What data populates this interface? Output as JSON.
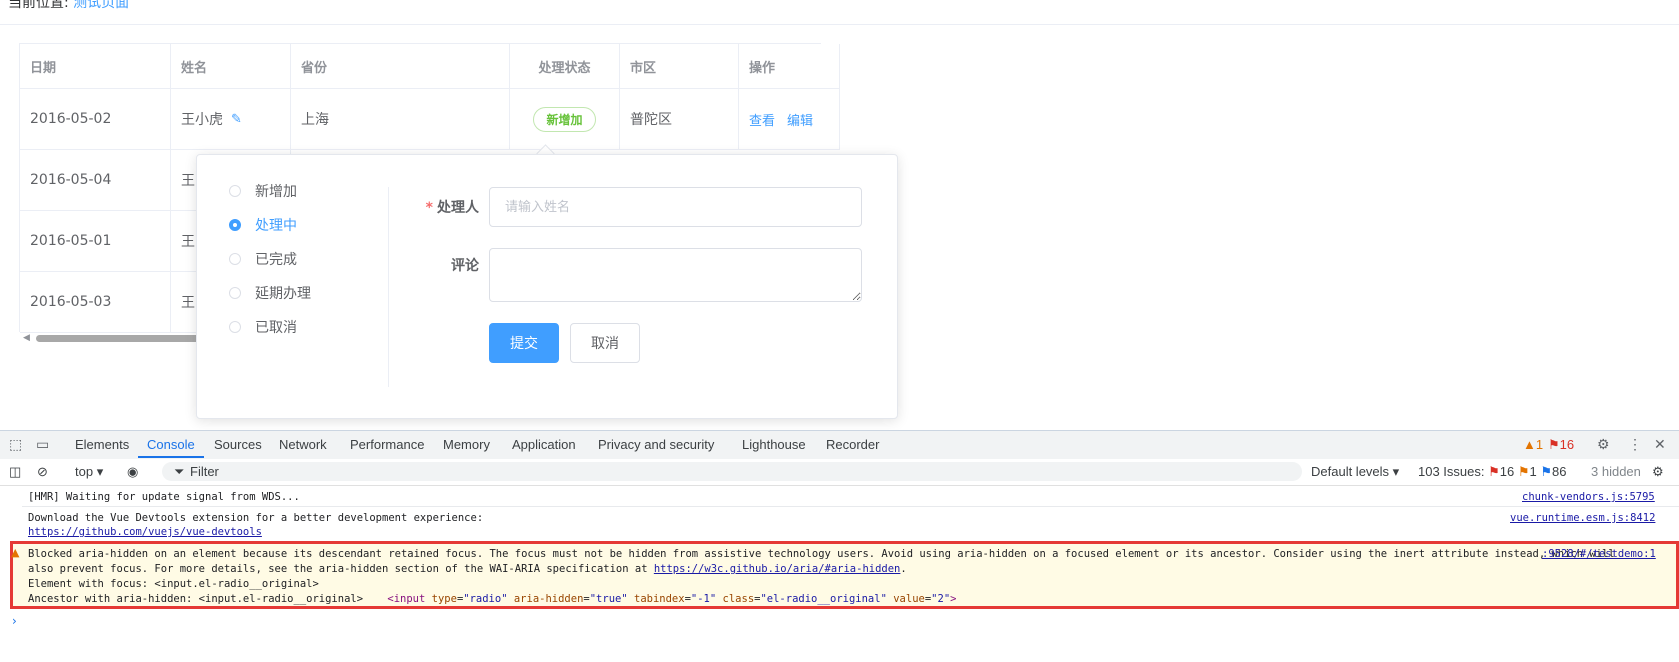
{
  "breadcrumb": {
    "label": "当前位置:",
    "current": "测试页面"
  },
  "table": {
    "headers": [
      "日期",
      "姓名",
      "省份",
      "处理状态",
      "市区",
      "操作"
    ],
    "rows": [
      {
        "date": "2016-05-02",
        "name": "王小虎",
        "province": "上海",
        "status": "新增加",
        "district": "普陀区",
        "actions": [
          "查看",
          "编辑"
        ]
      },
      {
        "date": "2016-05-04",
        "name": "王"
      },
      {
        "date": "2016-05-01",
        "name": "王"
      },
      {
        "date": "2016-05-03",
        "name": "王"
      }
    ]
  },
  "popover": {
    "radios": [
      {
        "label": "新增加",
        "checked": false
      },
      {
        "label": "处理中",
        "checked": true
      },
      {
        "label": "已完成",
        "checked": false
      },
      {
        "label": "延期办理",
        "checked": false
      },
      {
        "label": "已取消",
        "checked": false
      }
    ],
    "handler_label": "处理人",
    "handler_placeholder": "请输入姓名",
    "comment_label": "评论",
    "submit": "提交",
    "cancel": "取消"
  },
  "devtools": {
    "tabs": [
      "Elements",
      "Console",
      "Sources",
      "Network",
      "Performance",
      "Memory",
      "Application",
      "Privacy and security",
      "Lighthouse",
      "Recorder"
    ],
    "active_tab": "Console",
    "warn_count": "1",
    "error_count": "16",
    "toolbar": {
      "context": "top",
      "filter_placeholder": "Filter",
      "levels": "Default levels",
      "issues_label": "103 Issues:",
      "issues_errors": "16",
      "issues_warnings": "1",
      "issues_info": "86",
      "hidden": "3 hidden"
    },
    "console": {
      "line1": "[HMR] Waiting for update signal from WDS...",
      "line1_src": "chunk-vendors.js:5795",
      "line2a": "Download the Vue Devtools extension for a better development experience:",
      "line2b": "https://github.com/vuejs/vue-devtools",
      "line2_src": "vue.runtime.esm.js:8412",
      "warn_line1": "Blocked aria-hidden on an element because its descendant retained focus. The focus must not be hidden from assistive technology users. Avoid using aria-hidden on a focused element or its ancestor. Consider using the inert attribute instead, which will",
      "warn_src": ":9528/#/testdemo:1",
      "warn_line2a": "also prevent focus. For more details, see the aria-hidden section of the WAI-ARIA specification at",
      "warn_line2_link": "https://w3c.github.io/aria/#aria-hidden",
      "warn_line2_end": ".",
      "warn_line3": "Element with focus: <input.el-radio__original>",
      "warn_line4_prefix": "Ancestor with aria-hidden: <input.el-radio__original>",
      "code_open": "<input",
      "code_attrs": [
        {
          "name": "type",
          "value": "\"radio\""
        },
        {
          "name": "aria-hidden",
          "value": "\"true\""
        },
        {
          "name": "tabindex",
          "value": "\"-1\""
        },
        {
          "name": "class",
          "value": "\"el-radio__original\""
        },
        {
          "name": "value",
          "value": "\"2\""
        }
      ],
      "code_close": ">",
      "prompt": "›"
    }
  }
}
